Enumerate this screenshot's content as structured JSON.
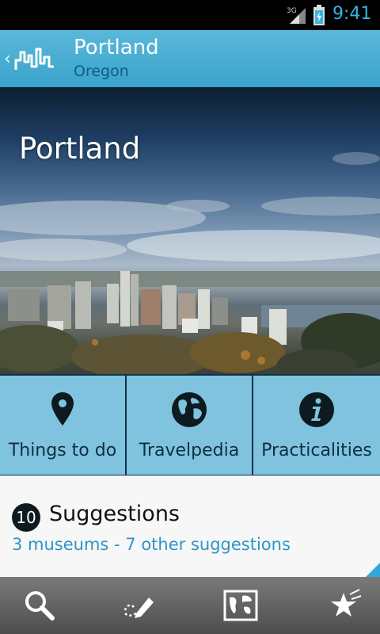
{
  "status_bar": {
    "network": "3G",
    "time": "9:41"
  },
  "action_bar": {
    "title": "Portland",
    "subtitle": "Oregon"
  },
  "hero": {
    "title": "Portland"
  },
  "tiles": [
    {
      "label": "Things to do",
      "icon": "map-pin-icon"
    },
    {
      "label": "Travelpedia",
      "icon": "globe-icon"
    },
    {
      "label": "Practicalities",
      "icon": "info-icon"
    }
  ],
  "suggestions": {
    "count": "10",
    "title": "Suggestions",
    "detail": "3 museums - 7 other suggestions"
  },
  "bottom_bar": {
    "items": [
      "search-icon",
      "edit-icon",
      "map-icon",
      "favorites-icon"
    ]
  },
  "colors": {
    "accent": "#33b5e5",
    "action_bar": "#4aaed5",
    "tile": "#7fc3df",
    "link": "#2c95c8"
  }
}
